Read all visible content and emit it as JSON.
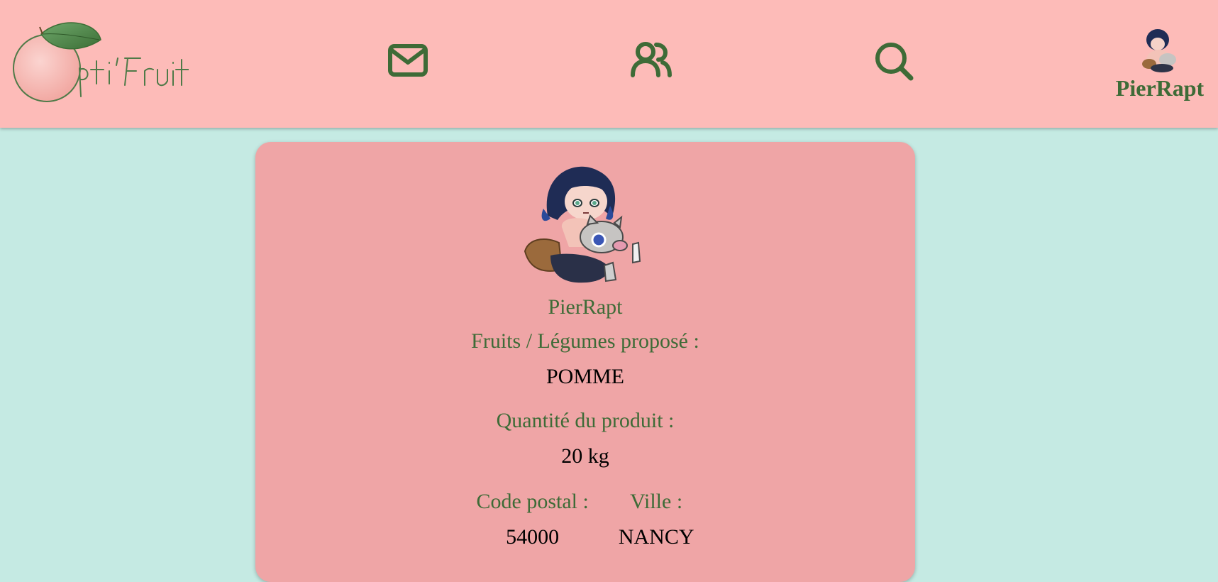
{
  "header": {
    "logo_text": "Opti'Fruit",
    "nav": [
      {
        "icon": "mail-icon"
      },
      {
        "icon": "users-icon"
      },
      {
        "icon": "search-icon"
      }
    ],
    "user": {
      "name": "PierRapt",
      "avatar": "character-avatar"
    }
  },
  "profile": {
    "username": "PierRapt",
    "products_label": "Fruits / Légumes proposé :",
    "product": "POMME",
    "quantity_label": "Quantité du produit :",
    "quantity": "20 kg",
    "postal_label": "Code postal :",
    "postal_code": "54000",
    "city_label": "Ville :",
    "city": "NANCY"
  },
  "colors": {
    "header_bg": "#fdbbb8",
    "page_bg": "#c5eae3",
    "card_bg": "#efa5a6",
    "accent_green": "#3e6b37"
  }
}
